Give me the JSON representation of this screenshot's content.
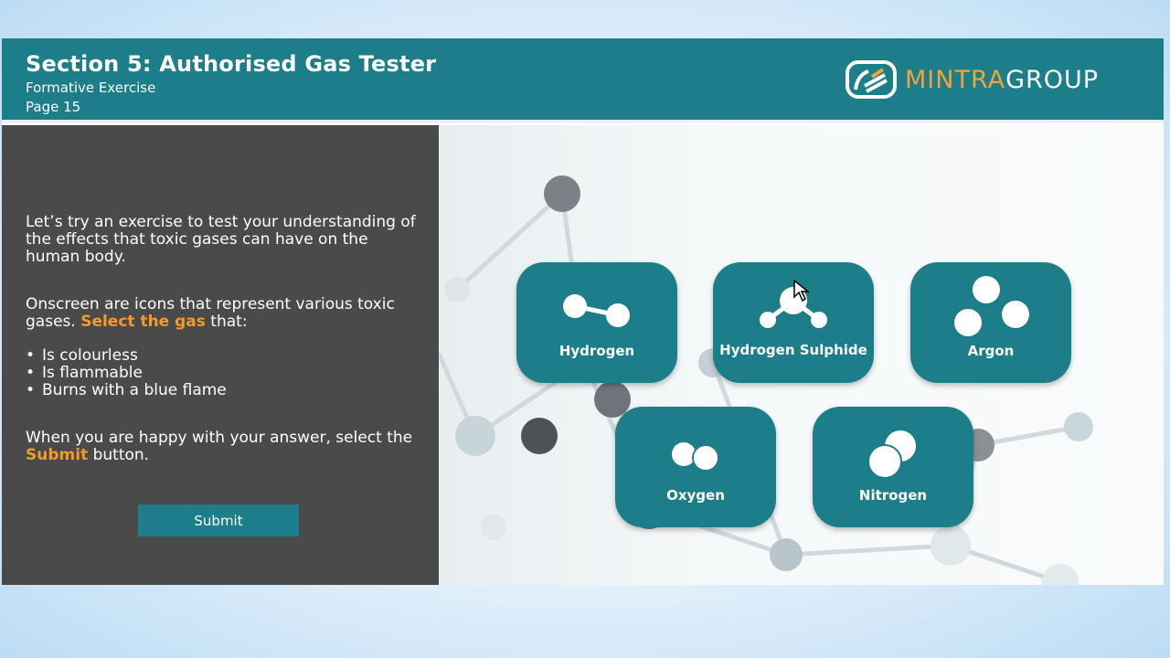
{
  "header": {
    "title": "Section 5: Authorised Gas Tester",
    "subtitle": "Formative Exercise",
    "page": "Page 15",
    "logo_part1": "MINTRA",
    "logo_part2": "GROUP"
  },
  "instructions": {
    "intro": "Let’s try an exercise to test your understanding of the effects that toxic gases can have on the human body.",
    "p2_before": "Onscreen are icons that represent various toxic gases. ",
    "p2_highlight": "Select the gas",
    "p2_after": " that:",
    "bullets": [
      "Is colourless",
      "Is flammable",
      "Burns with a blue flame"
    ],
    "p3_before": "When you are happy with your answer, select the ",
    "p3_highlight": "Submit",
    "p3_after": " button.",
    "submit_label": "Submit"
  },
  "gases": [
    {
      "label": "Hydrogen",
      "icon": "hydrogen-molecule-icon"
    },
    {
      "label": "Hydrogen Sulphide",
      "icon": "hydrogen-sulphide-molecule-icon"
    },
    {
      "label": "Argon",
      "icon": "argon-atoms-icon"
    },
    {
      "label": "Oxygen",
      "icon": "oxygen-molecule-icon"
    },
    {
      "label": "Nitrogen",
      "icon": "nitrogen-molecule-icon"
    }
  ],
  "colors": {
    "teal": "#1b7e88",
    "accent_orange": "#f39a2c",
    "panel_dark": "#4a4a4a"
  }
}
